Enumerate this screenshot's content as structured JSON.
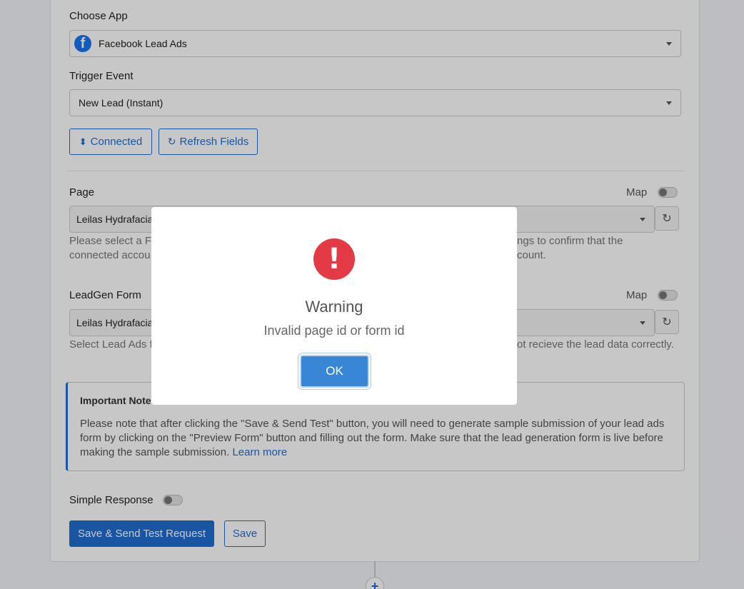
{
  "form": {
    "choose_app_label": "Choose App",
    "app_value": "Facebook Lead Ads",
    "trigger_event_label": "Trigger Event",
    "trigger_event_value": "New Lead (Instant)",
    "connected_label": "Connected",
    "refresh_fields_label": "Refresh Fields",
    "page_label": "Page",
    "page_map_label": "Map",
    "page_value": "Leilas Hydrafacia",
    "page_help_left_1": "Please select a Fa",
    "page_help_left_2": "connected accou",
    "page_help_right_1": "ngs to confirm that the",
    "page_help_right_2": "count.",
    "leadgen_label": "LeadGen Form",
    "leadgen_map_label": "Map",
    "leadgen_value": "Leilas Hydrafacia",
    "leadgen_help_left": "Select Lead Ads f",
    "leadgen_help_right": "ot recieve the lead data correctly."
  },
  "note": {
    "title": "Important Note",
    "body": "Please note that after clicking the \"Save & Send Test\" button, you will need to generate sample submission of your lead ads form by clicking on the \"Preview Form\" button and filling out the form. Make sure that the lead generation form is live before making the sample submission.",
    "link": "Learn more"
  },
  "footer": {
    "simple_response_label": "Simple Response",
    "save_send_label": "Save & Send Test Request",
    "save_label": "Save"
  },
  "modal": {
    "title": "Warning",
    "message": "Invalid page id or form id",
    "ok_label": "OK"
  },
  "colors": {
    "accent": "#1f6fd1",
    "warning": "#e33a45",
    "facebook": "#1877f2"
  }
}
